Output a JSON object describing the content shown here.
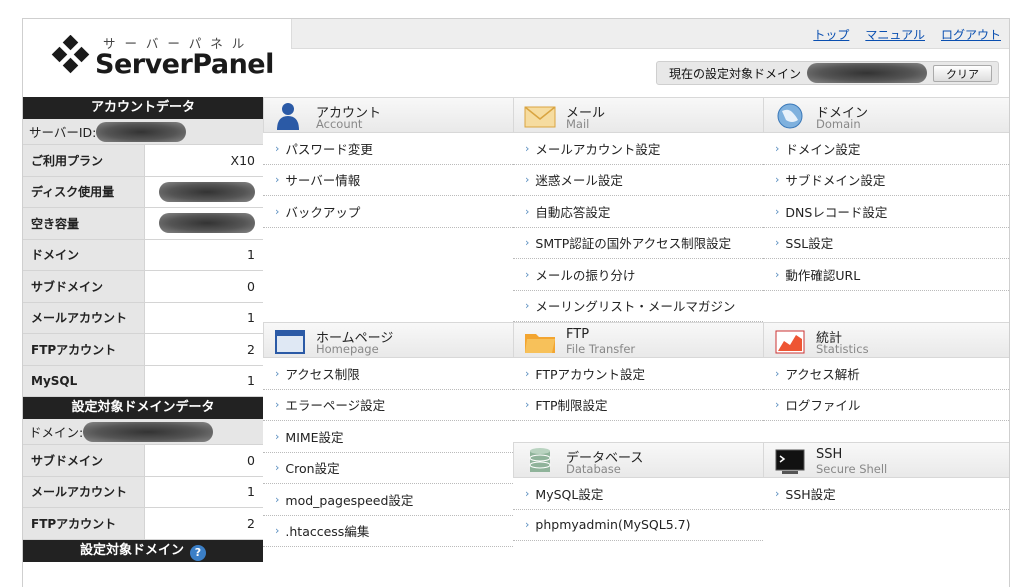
{
  "header": {
    "logo_kana": "サーバーパネル",
    "logo_name": "ServerPanel",
    "links": [
      "トップ",
      "マニュアル",
      "ログアウト"
    ],
    "current_domain_label": "現在の設定対象ドメイン",
    "clear_button": "クリア"
  },
  "sidebar": {
    "account_title": "アカウントデータ",
    "server_id_label": "サーバーID:",
    "account_rows": [
      {
        "label": "ご利用プラン",
        "value": "X10"
      },
      {
        "label": "ディスク使用量",
        "value": ""
      },
      {
        "label": "空き容量",
        "value": ""
      },
      {
        "label": "ドメイン",
        "value": "1"
      },
      {
        "label": "サブドメイン",
        "value": "0"
      },
      {
        "label": "メールアカウント",
        "value": "1"
      },
      {
        "label": "FTPアカウント",
        "value": "2"
      },
      {
        "label": "MySQL",
        "value": "1"
      }
    ],
    "domain_title": "設定対象ドメインデータ",
    "domain_label": "ドメイン:",
    "domain_rows": [
      {
        "label": "サブドメイン",
        "value": "0"
      },
      {
        "label": "メールアカウント",
        "value": "1"
      },
      {
        "label": "FTPアカウント",
        "value": "2"
      }
    ],
    "target_title": "設定対象ドメイン",
    "help": "?"
  },
  "sections": {
    "account": {
      "jp": "アカウント",
      "en": "Account",
      "items": [
        "パスワード変更",
        "サーバー情報",
        "バックアップ"
      ]
    },
    "mail": {
      "jp": "メール",
      "en": "Mail",
      "items": [
        "メールアカウント設定",
        "迷惑メール設定",
        "自動応答設定",
        "SMTP認証の国外アクセス制限設定",
        "メールの振り分け",
        "メーリングリスト・メールマガジン"
      ]
    },
    "domain": {
      "jp": "ドメイン",
      "en": "Domain",
      "items": [
        "ドメイン設定",
        "サブドメイン設定",
        "DNSレコード設定",
        "SSL設定",
        "動作確認URL"
      ]
    },
    "homepage": {
      "jp": "ホームページ",
      "en": "Homepage",
      "items": [
        "アクセス制限",
        "エラーページ設定",
        "MIME設定",
        "Cron設定",
        "mod_pagespeed設定",
        ".htaccess編集"
      ]
    },
    "ftp": {
      "jp": "FTP",
      "en": "File Transfer",
      "items": [
        "FTPアカウント設定",
        "FTP制限設定"
      ]
    },
    "stats": {
      "jp": "統計",
      "en": "Statistics",
      "items": [
        "アクセス解析",
        "ログファイル"
      ]
    },
    "database": {
      "jp": "データベース",
      "en": "Database",
      "items": [
        "MySQL設定",
        "phpmyadmin(MySQL5.7)"
      ]
    },
    "ssh": {
      "jp": "SSH",
      "en": "Secure Shell",
      "items": [
        "SSH設定"
      ]
    }
  },
  "colors": {
    "accent_link": "#0a4fb0",
    "sidebar_header": "#222222",
    "arrow": "#5a8fc0"
  }
}
